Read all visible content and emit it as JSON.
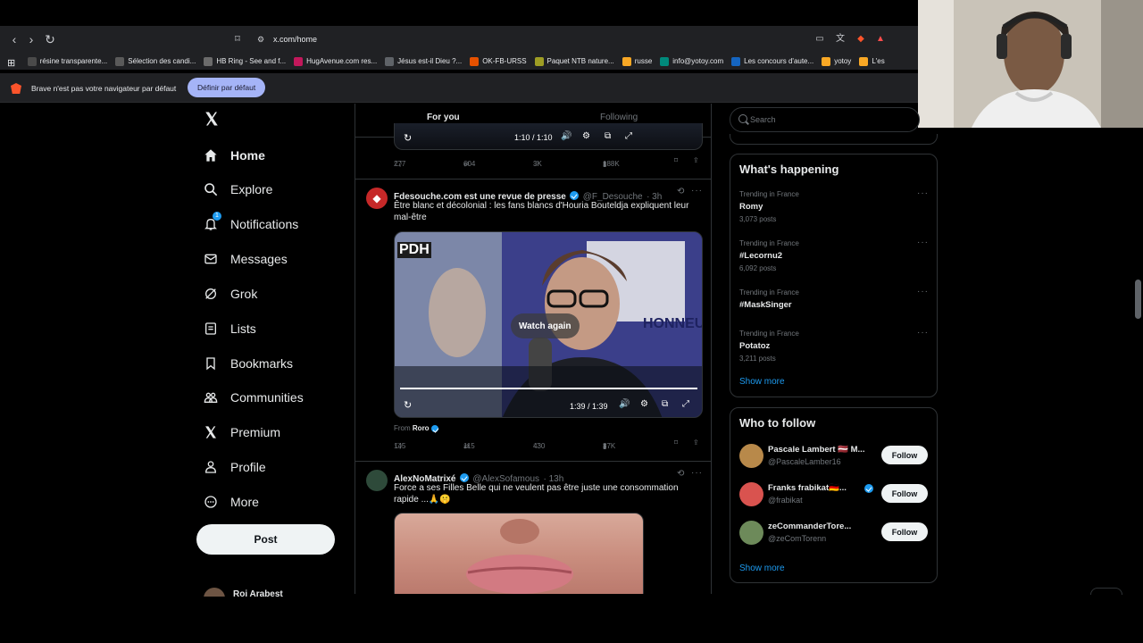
{
  "browser": {
    "url": "x.com/home",
    "bookmarks": [
      {
        "label": "résine transparente...",
        "color": "#4a4a4a"
      },
      {
        "label": "Sélection des candi...",
        "color": "#5a5a5a"
      },
      {
        "label": "HB Ring - See and f...",
        "color": "#6b6b6b"
      },
      {
        "label": "HugAvenue.com res...",
        "color": "#c2185b"
      },
      {
        "label": "Jésus est-il Dieu ?...",
        "color": "#5f6368"
      },
      {
        "label": "OK-FB-URSS",
        "color": "#e65100"
      },
      {
        "label": "Paquet NTB nature...",
        "color": "#9e9d24"
      },
      {
        "label": "russe",
        "color": "#f9a825"
      },
      {
        "label": "info@yotoy.com",
        "color": "#00897b"
      },
      {
        "label": "Les concours d'aute...",
        "color": "#1565c0"
      },
      {
        "label": "yotoy",
        "color": "#f9a825"
      },
      {
        "label": "L'es",
        "color": "#f9a825"
      }
    ],
    "infobar_text": "Brave n'est pas votre navigateur par défaut",
    "infobar_button": "Définir par défaut"
  },
  "nav": {
    "items": [
      {
        "label": "Home",
        "icon": "home-icon"
      },
      {
        "label": "Explore",
        "icon": "search-icon"
      },
      {
        "label": "Notifications",
        "icon": "bell-icon",
        "badge": "1"
      },
      {
        "label": "Messages",
        "icon": "envelope-icon"
      },
      {
        "label": "Grok",
        "icon": "grok-icon"
      },
      {
        "label": "Lists",
        "icon": "list-icon"
      },
      {
        "label": "Bookmarks",
        "icon": "bookmark-icon"
      },
      {
        "label": "Communities",
        "icon": "communities-icon"
      },
      {
        "label": "Premium",
        "icon": "x-logo-icon"
      },
      {
        "label": "Profile",
        "icon": "person-icon"
      },
      {
        "label": "More",
        "icon": "more-circle-icon"
      }
    ],
    "post_button": "Post",
    "account_name": "Roi Arabest"
  },
  "timeline": {
    "tabs": {
      "for_you": "For you",
      "following": "Following"
    },
    "prev_tweet": {
      "video_time": "1:10 / 1:10",
      "replies": "277",
      "reposts": "604",
      "likes": "3K",
      "views": "188K"
    },
    "tweet1": {
      "name": "Fdesouche.com est une revue de presse",
      "handle": "@F_Desouche",
      "time": "· 3h",
      "text": "Être blanc et décolonial : les fans blancs d'Houria Bouteldja expliquent leur mal-être",
      "video_logo": "PDH",
      "video_overlay": "Watch again",
      "video_bg_text": "HONNEU",
      "video_time": "1:39 / 1:39",
      "from_label": "From",
      "from_name": "Roro",
      "replies": "145",
      "reposts": "115",
      "likes": "430",
      "views": "37K"
    },
    "tweet2": {
      "name": "AlexNoMatrixé",
      "handle": "@AlexSofamous",
      "time": "· 13h",
      "text": "Force a ses Filles Belle qui ne veulent pas être juste une consommation rapide ...🙏🤫"
    }
  },
  "sidebar": {
    "search_placeholder": "Search",
    "whats_happening": {
      "title": "What's happening",
      "trends": [
        {
          "context": "Trending in France",
          "name": "Romy",
          "posts": "3,073 posts"
        },
        {
          "context": "Trending in France",
          "name": "#Lecornu2",
          "posts": "6,092 posts"
        },
        {
          "context": "Trending in France",
          "name": "#MaskSinger",
          "posts": ""
        },
        {
          "context": "Trending in France",
          "name": "Potatoz",
          "posts": "3,211 posts"
        }
      ],
      "show_more": "Show more"
    },
    "who_to_follow": {
      "title": "Who to follow",
      "accounts": [
        {
          "name": "Pascale Lambert 🇱🇻 M...",
          "handle": "@PascaleLamber16",
          "follow": "Follow",
          "avatar_color": "#b8894a"
        },
        {
          "name": "Franks frabikat🇩🇪...",
          "handle": "@frabikat",
          "follow": "Follow",
          "avatar_color": "#d9534f"
        },
        {
          "name": "zeCommanderTore...",
          "handle": "@zeComTorenn",
          "follow": "Follow",
          "avatar_color": "#6d8a5a"
        }
      ],
      "show_more": "Show more"
    }
  },
  "colors": {
    "accent": "#1d9bf0",
    "bg": "#000000",
    "border": "#2f3336",
    "muted": "#71767b"
  }
}
